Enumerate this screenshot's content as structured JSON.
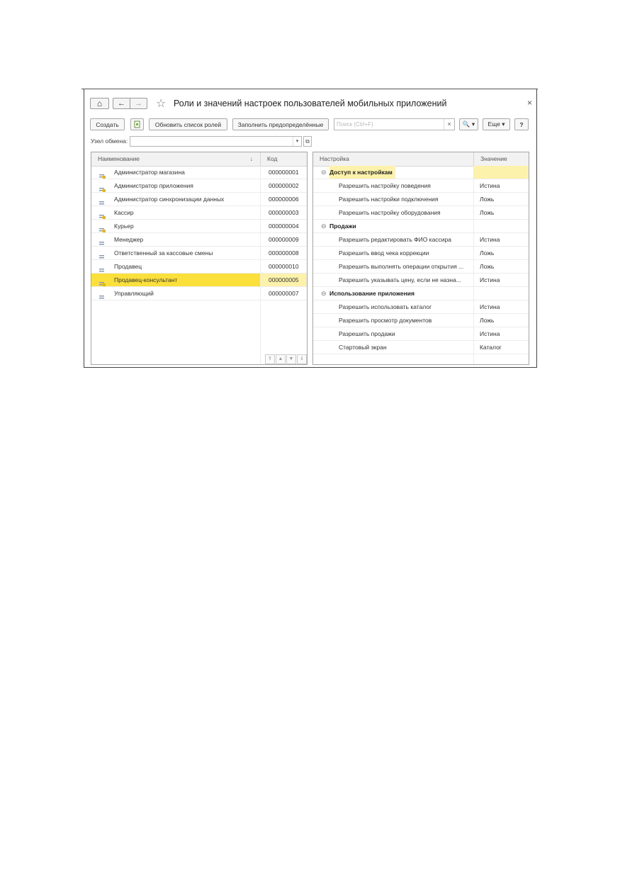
{
  "window": {
    "title": "Роли и значений настроек пользователей мобильных приложений",
    "close_label": "×",
    "home_icon": "⌂",
    "back_icon": "←",
    "forward_icon": "→",
    "star_icon": "☆"
  },
  "toolbar": {
    "create_label": "Создать",
    "refresh_roles_label": "Обновить список ролей",
    "fill_predefined_label": "Заполнить предопределённые",
    "search_placeholder": "Поиск (Ctrl+F)",
    "search_clear": "×",
    "search_btn": "🔍 ▾",
    "more_label": "Еще ▾",
    "help_label": "?"
  },
  "node": {
    "label": "Узел обмена:",
    "value": "",
    "arrow": "▾",
    "open_icon": "⧉"
  },
  "roles_table": {
    "col_name": "Наименование",
    "col_code": "Код",
    "sort_icon": "↓",
    "rows": [
      {
        "name": "Администратор магазина",
        "code": "000000001",
        "icon": "role-icon-yellow"
      },
      {
        "name": "Администратор приложения",
        "code": "000000002",
        "icon": "role-icon-yellow"
      },
      {
        "name": "Администратор синхронизации данных",
        "code": "000000006",
        "icon": "role-icon-gray"
      },
      {
        "name": "Кассир",
        "code": "000000003",
        "icon": "role-icon-yellow"
      },
      {
        "name": "Курьер",
        "code": "000000004",
        "icon": "role-icon-yellow"
      },
      {
        "name": "Менеджер",
        "code": "000000009",
        "icon": "role-icon-gray"
      },
      {
        "name": "Ответственный за кассовые смены",
        "code": "000000008",
        "icon": "role-icon-gray"
      },
      {
        "name": "Продавец",
        "code": "000000010",
        "icon": "role-icon-gray"
      },
      {
        "name": "Продавец-консультант",
        "code": "000000005",
        "icon": "role-icon-yellow"
      },
      {
        "name": "Управляющий",
        "code": "000000007",
        "icon": "role-icon-gray"
      }
    ],
    "selected_index": 8,
    "scroll_icons": [
      "⇑",
      "▲",
      "▼",
      "⇓"
    ]
  },
  "settings_table": {
    "col_setting": "Настройка",
    "col_value": "Значение",
    "collapse_icon": "⊖",
    "rows": [
      {
        "type": "group",
        "label": "Доступ к настройкам",
        "value": ""
      },
      {
        "type": "item",
        "label": "Разрешить настройку поведения",
        "value": "Истина"
      },
      {
        "type": "item",
        "label": "Разрешить настройки подключения",
        "value": "Ложь"
      },
      {
        "type": "item",
        "label": "Разрешить настройку оборудования",
        "value": "Ложь"
      },
      {
        "type": "group",
        "label": "Продажи",
        "value": ""
      },
      {
        "type": "item",
        "label": "Разрешить редактировать ФИО кассира",
        "value": "Истина"
      },
      {
        "type": "item",
        "label": "Разрешить ввод чека коррекции",
        "value": "Ложь"
      },
      {
        "type": "item",
        "label": "Разрешить выполнять операции открытия ...",
        "value": "Ложь"
      },
      {
        "type": "item",
        "label": "Разрешить указывать цену, если не назна...",
        "value": "Истина"
      },
      {
        "type": "group",
        "label": "Использование приложения",
        "value": ""
      },
      {
        "type": "item",
        "label": "Разрешить использовать каталог",
        "value": "Истина"
      },
      {
        "type": "item",
        "label": "Разрешить просмотр документов",
        "value": "Ложь"
      },
      {
        "type": "item",
        "label": "Разрешить продажи",
        "value": "Истина"
      },
      {
        "type": "item",
        "label": "Стартовый экран",
        "value": "Каталог"
      }
    ],
    "highlighted_index": 0
  },
  "colors": {
    "selection": "#fbe03c",
    "selection_light": "#fdf2ab",
    "role_yellow": "#e6b800",
    "role_gray": "#8a9bb0"
  }
}
